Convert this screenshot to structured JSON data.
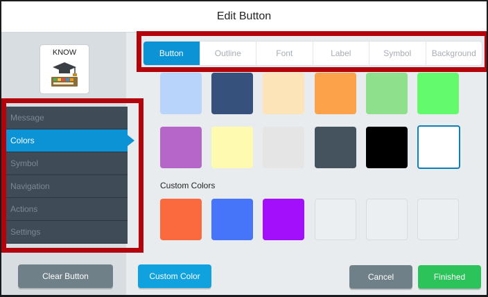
{
  "dialog": {
    "title": "Edit Button"
  },
  "preview": {
    "caption": "KNOW",
    "icon": "graduation-cap-keyboard-icon"
  },
  "menu": {
    "items": [
      {
        "label": "Message",
        "active": false
      },
      {
        "label": "Colors",
        "active": true
      },
      {
        "label": "Symbol",
        "active": false
      },
      {
        "label": "Navigation",
        "active": false
      },
      {
        "label": "Actions",
        "active": false
      },
      {
        "label": "Settings",
        "active": false
      }
    ]
  },
  "tabs": [
    {
      "label": "Button",
      "active": true
    },
    {
      "label": "Outline",
      "active": false
    },
    {
      "label": "Font",
      "active": false
    },
    {
      "label": "Label",
      "active": false
    },
    {
      "label": "Symbol",
      "active": false
    },
    {
      "label": "Background",
      "active": false
    }
  ],
  "palette": {
    "row1": [
      "#b9d4fb",
      "#36527c",
      "#fde4b8",
      "#fba24a",
      "#8fe08c",
      "#63fa6e"
    ],
    "row2": [
      "#b566c8",
      "#fefbb0",
      "#e5e5e5",
      "#45535e",
      "#000000",
      "#ffffff"
    ],
    "selected": "#ffffff"
  },
  "custom_colors": {
    "label": "Custom Colors",
    "swatches": [
      "#fb6a3e",
      "#4675fa",
      "#a30efb",
      "",
      "",
      ""
    ]
  },
  "footer": {
    "clear_label": "Clear Button",
    "custom_color_label": "Custom Color",
    "cancel_label": "Cancel",
    "finished_label": "Finished"
  },
  "colors": {
    "accent": "#0b93d6",
    "highlight_frame": "#b3040c",
    "finished": "#2cc35b",
    "neutral_button": "#6f8088"
  }
}
